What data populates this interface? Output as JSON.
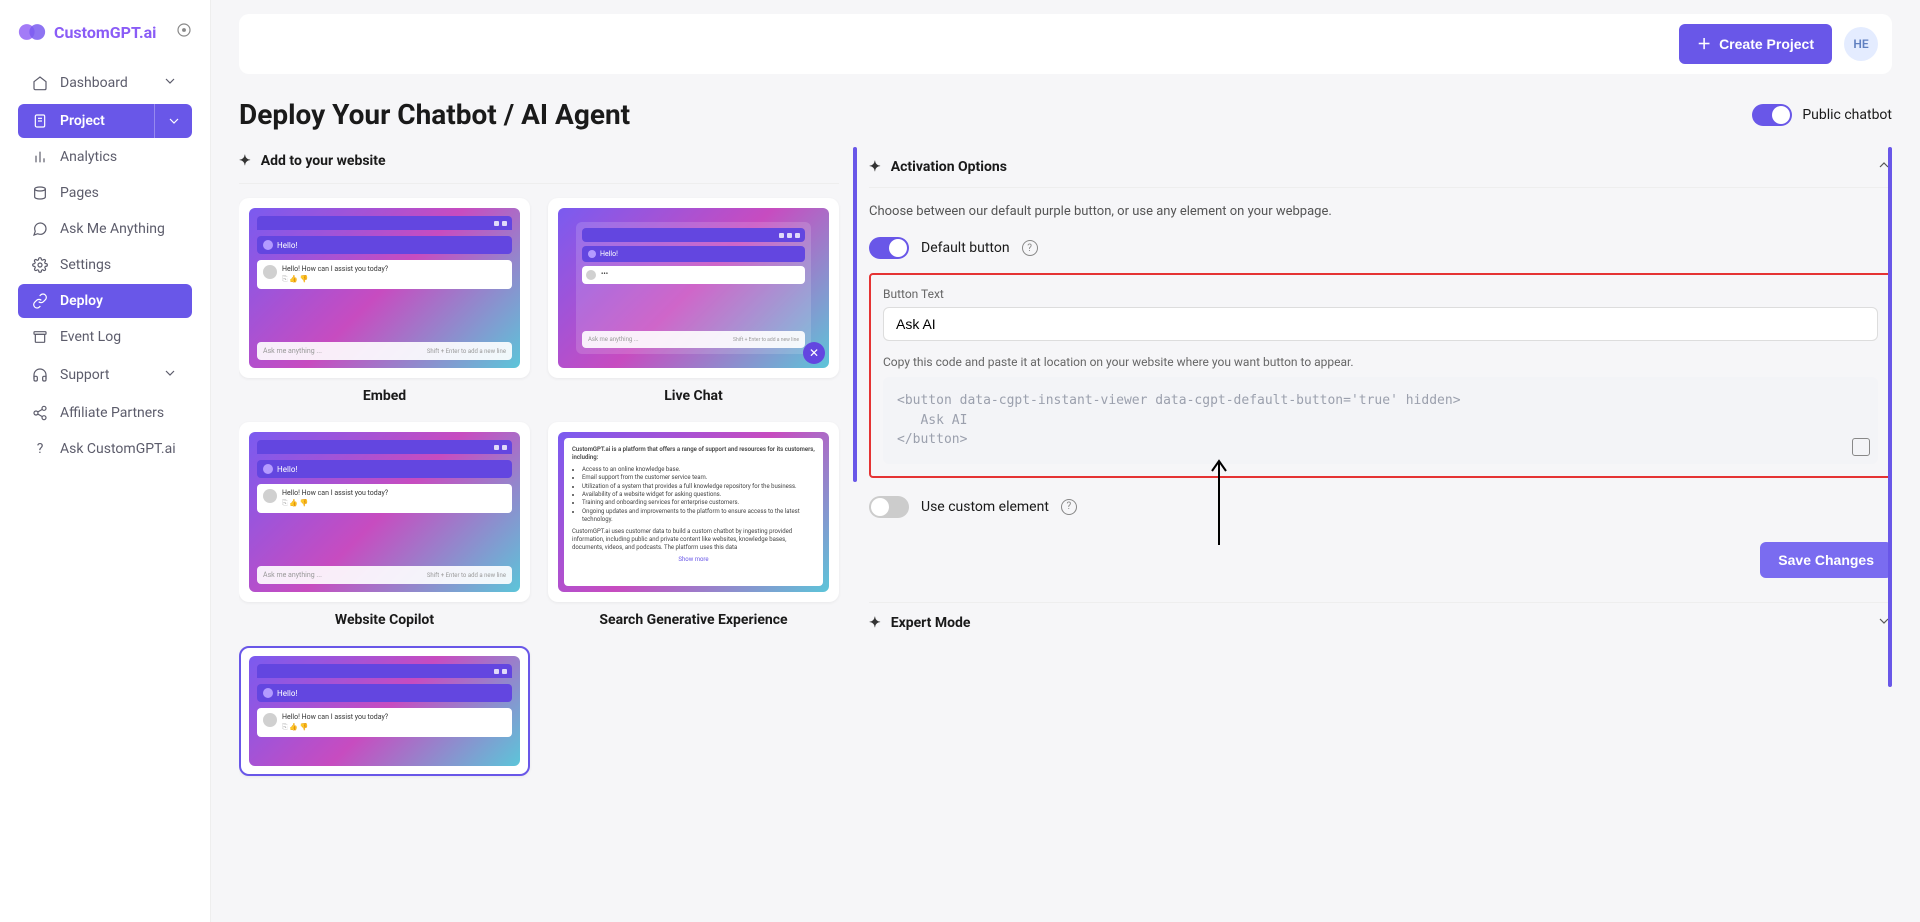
{
  "brand": "CustomGPT.ai",
  "topbar": {
    "create": "Create Project",
    "avatar": "HE"
  },
  "nav": {
    "dashboard": "Dashboard",
    "project": "Project",
    "analytics": "Analytics",
    "pages": "Pages",
    "ask": "Ask Me Anything",
    "settings": "Settings",
    "deploy": "Deploy",
    "eventlog": "Event Log",
    "support": "Support",
    "affiliates": "Affiliate Partners",
    "askcgpt": "Ask CustomGPT.ai"
  },
  "page": {
    "title": "Deploy Your Chatbot / AI Agent",
    "public_toggle": "Public chatbot"
  },
  "left": {
    "heading": "Add to your website",
    "cards": {
      "embed": "Embed",
      "livechat": "Live Chat",
      "copilot": "Website Copilot",
      "sge": "Search Generative Experience"
    }
  },
  "thumb": {
    "hello": "Hello!",
    "assist": "Hello! How can I assist you today?",
    "placeholder": "Ask me anything ...",
    "hint": "Shift + Enter to add a new line",
    "sge_title": "CustomGPT.ai is a platform that offers a range of support and resources for its customers, including:",
    "sge_items": [
      "Access to an online knowledge base.",
      "Email support from the customer service team.",
      "Utilization of a system that provides a full knowledge repository for the business.",
      "Availability of a website widget for asking questions.",
      "Training and onboarding services for enterprise customers.",
      "Ongoing updates and improvements to the platform to ensure access to the latest technology."
    ],
    "sge_para": "CustomGPT.ai uses customer data to build a custom chatbot by ingesting provided information, including public and private content like websites, knowledge bases, documents, videos, and podcasts. The platform uses this data",
    "showmore": "Show more"
  },
  "right": {
    "activation": "Activation Options",
    "choose": "Choose between our default purple button, or use any element on your webpage.",
    "default_button": "Default button",
    "button_text_label": "Button Text",
    "button_text_value": "Ask AI",
    "copy_label": "Copy this code and paste it at location on your website where you want button to appear.",
    "code": "<button data-cgpt-instant-viewer data-cgpt-default-button='true' hidden>\n   Ask AI\n</button>",
    "custom": "Use custom element",
    "save": "Save Changes",
    "expert": "Expert Mode"
  }
}
